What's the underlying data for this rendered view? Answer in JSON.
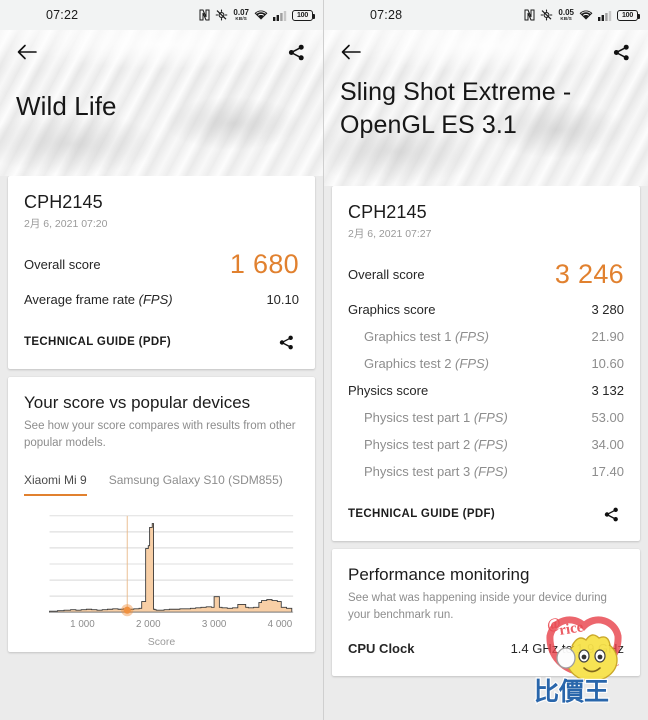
{
  "accent": "#e1812f",
  "left": {
    "status": {
      "time": "07:22",
      "nfc": "nfc-icon",
      "location_off": "location-off-icon",
      "net_speed_value": "0.07",
      "net_speed_unit": "KB/S",
      "wifi": "wifi-icon",
      "signal": "cellular-signal-icon",
      "battery": "100"
    },
    "nav": {
      "back": "back-arrow-icon",
      "share": "share-icon"
    },
    "hero_title": "Wild Life",
    "result": {
      "device": "CPH2145",
      "date": "2月 6, 2021 07:20",
      "rows": [
        {
          "label": "Overall score",
          "value": "1 680",
          "type": "overall"
        },
        {
          "label": "Average frame rate ",
          "label_em": "(FPS)",
          "value": "10.10",
          "type": "main"
        }
      ],
      "tech_guide": "TECHNICAL GUIDE (PDF)",
      "tech_share": "share-icon"
    },
    "compare": {
      "title": "Your score vs popular devices",
      "subtitle": "See how your score compares with results from other popular models.",
      "tabs": [
        {
          "label": "Xiaomi Mi 9",
          "active": true
        },
        {
          "label": "Samsung Galaxy S10 (SDM855)",
          "active": false
        }
      ]
    }
  },
  "right": {
    "status": {
      "time": "07:28",
      "nfc": "nfc-icon",
      "location_off": "location-off-icon",
      "net_speed_value": "0.05",
      "net_speed_unit": "KB/S",
      "wifi": "wifi-icon",
      "signal": "cellular-signal-icon",
      "battery": "100"
    },
    "nav": {
      "back": "back-arrow-icon",
      "share": "share-icon"
    },
    "hero_title": "Sling Shot Extreme - OpenGL ES 3.1",
    "result": {
      "device": "CPH2145",
      "date": "2月 6, 2021 07:27",
      "rows": [
        {
          "label": "Overall score",
          "value": "3 246",
          "type": "overall"
        },
        {
          "label": "Graphics score",
          "value": "3 280",
          "type": "main"
        },
        {
          "label": "Graphics test 1 ",
          "label_em": "(FPS)",
          "value": "21.90",
          "type": "sub"
        },
        {
          "label": "Graphics test 2 ",
          "label_em": "(FPS)",
          "value": "10.60",
          "type": "sub"
        },
        {
          "label": "Physics score",
          "value": "3 132",
          "type": "main"
        },
        {
          "label": "Physics test part 1 ",
          "label_em": "(FPS)",
          "value": "53.00",
          "type": "sub"
        },
        {
          "label": "Physics test part 2 ",
          "label_em": "(FPS)",
          "value": "34.00",
          "type": "sub"
        },
        {
          "label": "Physics test part 3 ",
          "label_em": "(FPS)",
          "value": "17.40",
          "type": "sub"
        }
      ],
      "tech_guide": "TECHNICAL GUIDE (PDF)",
      "tech_share": "share-icon"
    },
    "perf": {
      "title": "Performance monitoring",
      "subtitle": "See what was happening inside your device during your benchmark run.",
      "rows": [
        {
          "label": "CPU Clock",
          "value": "1.4 GHz to 1.9 GHz"
        }
      ]
    }
  },
  "watermark": {
    "text_top": "@price.com.tw",
    "text_bottom": "比價王"
  },
  "chart_data": {
    "type": "area",
    "title": "Your score vs popular devices",
    "xlabel": "Score",
    "ylabel": "",
    "xlim": [
      500,
      4200
    ],
    "ylim": [
      0,
      100
    ],
    "grid": true,
    "legend": false,
    "marker": {
      "x": 1680,
      "y": 2,
      "label": "1 680",
      "color": "#f0913f"
    },
    "reference_line_x": 1680,
    "xticks": [
      1000,
      2000,
      3000,
      4000
    ],
    "xtick_labels": [
      "1 000",
      "2 000",
      "3 000",
      "4 000"
    ],
    "series": [
      {
        "name": "Xiaomi Mi 9 score distribution",
        "color": "#f8cfa6",
        "line_color": "#3a3a3a",
        "x": [
          500,
          620,
          720,
          820,
          900,
          980,
          1060,
          1140,
          1220,
          1300,
          1380,
          1460,
          1540,
          1620,
          1700,
          1780,
          1860,
          1900,
          1940,
          1960,
          1980,
          2000,
          2020,
          2060,
          2080,
          2100,
          2120,
          2160,
          2240,
          2320,
          2400,
          2480,
          2560,
          2640,
          2720,
          2800,
          2880,
          2960,
          3000,
          3040,
          3080,
          3120,
          3200,
          3280,
          3360,
          3440,
          3480,
          3520,
          3600,
          3680,
          3720,
          3800,
          3880,
          3960,
          4020,
          4100,
          4180
        ],
        "y": [
          1,
          1.5,
          2,
          2.5,
          2,
          2.5,
          3,
          2.5,
          2,
          2.5,
          3,
          3.5,
          3,
          3.5,
          3,
          3.5,
          4,
          11,
          11,
          66,
          66,
          69,
          88,
          92,
          3,
          2.5,
          2,
          2,
          2.5,
          3,
          3,
          3.5,
          3.5,
          4,
          4.5,
          5,
          5.5,
          5,
          16,
          16,
          5,
          4.5,
          4,
          4.5,
          8,
          8,
          5,
          4.5,
          5,
          10,
          12,
          13,
          12,
          11,
          5,
          4,
          3
        ]
      }
    ]
  }
}
